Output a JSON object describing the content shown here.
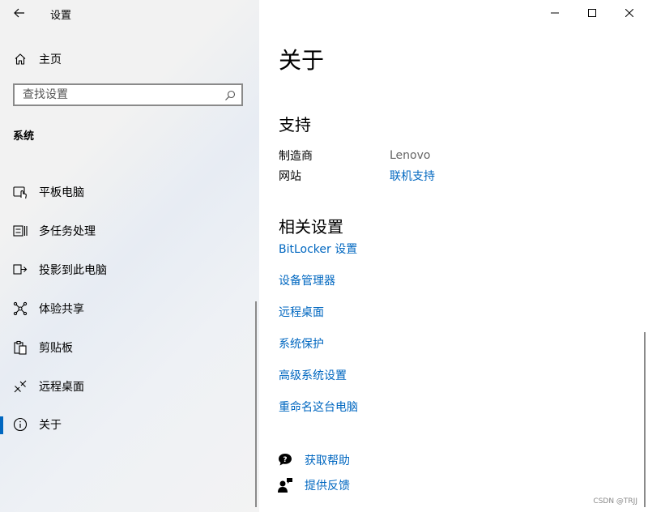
{
  "titlebar": {
    "app_title": "设置"
  },
  "sidebar": {
    "home_label": "主页",
    "search": {
      "placeholder": "查找设置",
      "value": ""
    },
    "section_title": "系统",
    "items": [
      {
        "label": "平板电脑",
        "icon": "tablet-icon"
      },
      {
        "label": "多任务处理",
        "icon": "multitasking-icon"
      },
      {
        "label": "投影到此电脑",
        "icon": "project-icon"
      },
      {
        "label": "体验共享",
        "icon": "shared-experiences-icon"
      },
      {
        "label": "剪贴板",
        "icon": "clipboard-icon"
      },
      {
        "label": "远程桌面",
        "icon": "remote-desktop-icon"
      },
      {
        "label": "关于",
        "icon": "info-icon",
        "selected": true
      }
    ]
  },
  "content": {
    "page_title": "关于",
    "support": {
      "heading": "支持",
      "manufacturer_label": "制造商",
      "manufacturer_value": "Lenovo",
      "website_label": "网站",
      "website_link": "联机支持"
    },
    "related": {
      "heading": "相关设置",
      "links": [
        "BitLocker 设置",
        "设备管理器",
        "远程桌面",
        "系统保护",
        "高级系统设置",
        "重命名这台电脑"
      ]
    },
    "help": {
      "get_help": "获取帮助",
      "feedback": "提供反馈"
    }
  },
  "watermark": "CSDN @TRJJ",
  "colors": {
    "accent": "#0067c0",
    "sidebar_bg": "#f2f2f2"
  }
}
